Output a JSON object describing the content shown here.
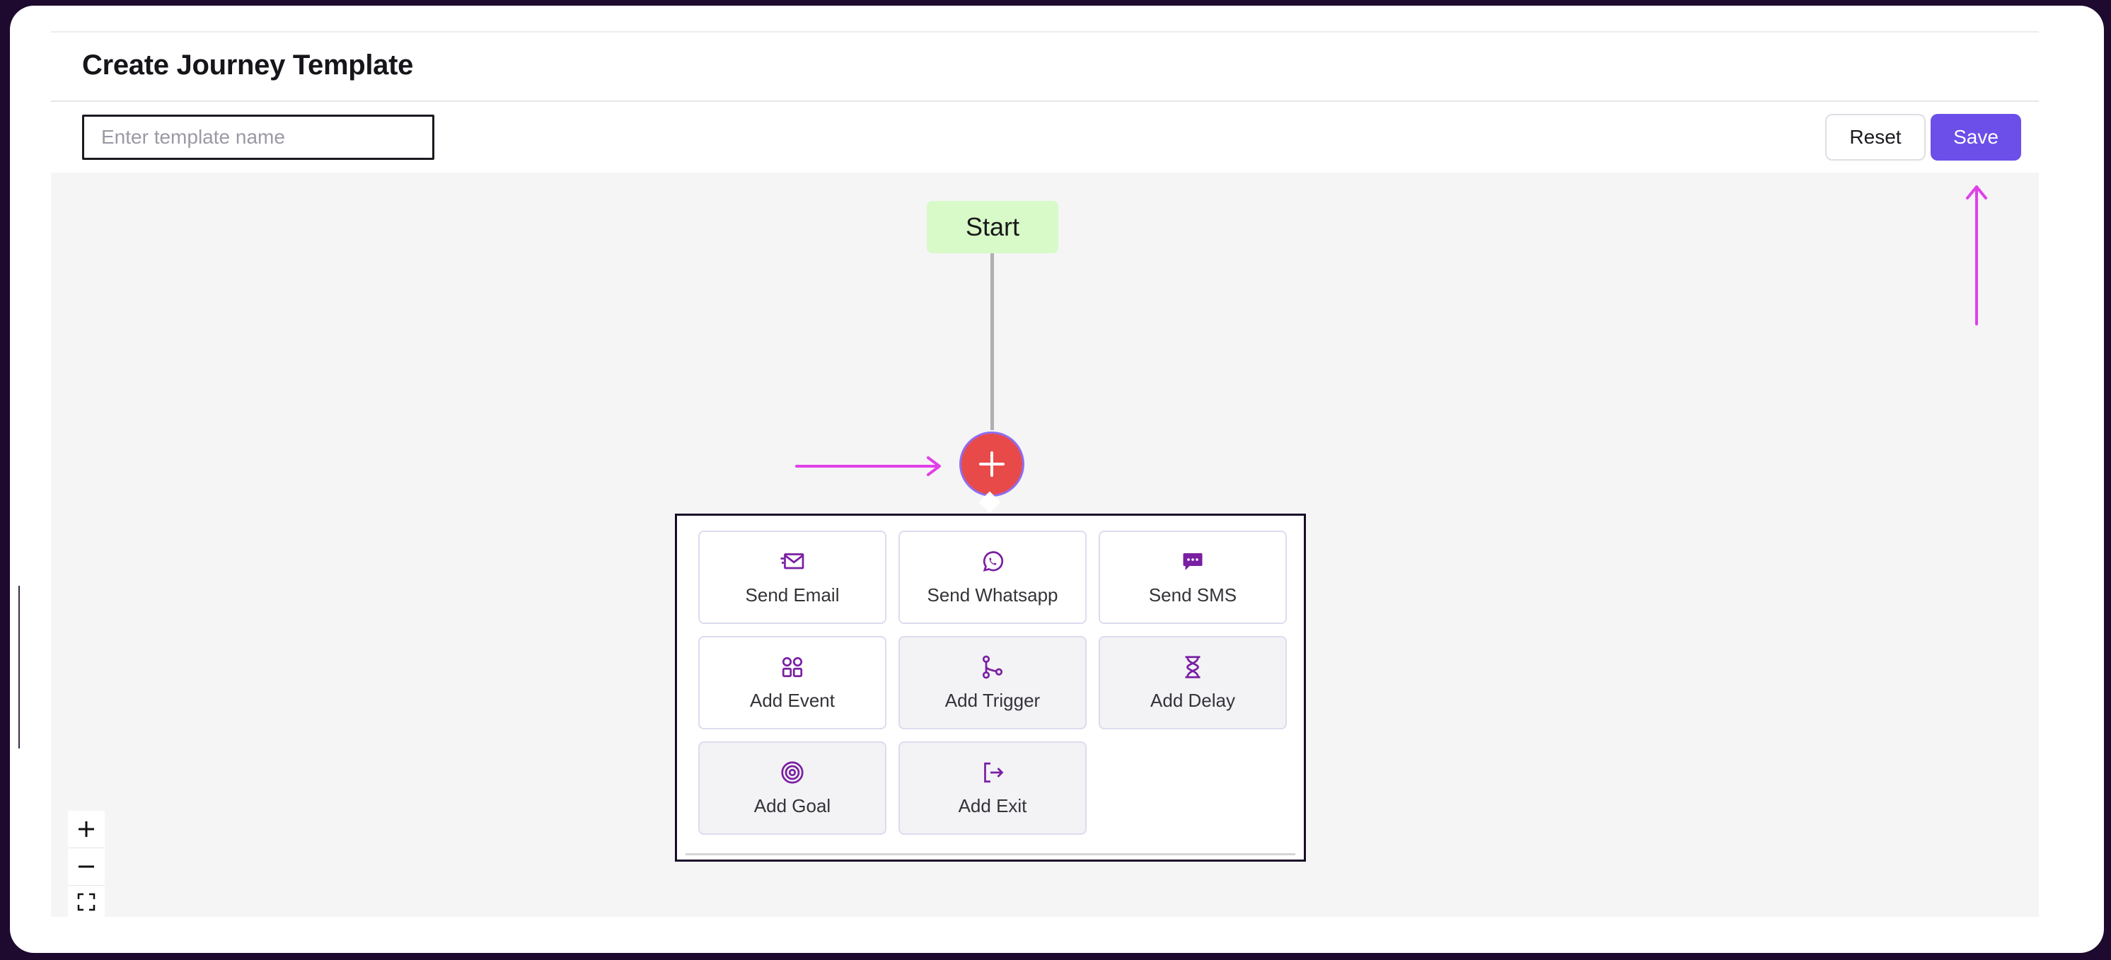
{
  "header": {
    "title": "Create Journey Template"
  },
  "template_name": {
    "placeholder": "Enter template name",
    "value": ""
  },
  "toolbar": {
    "reset_label": "Reset",
    "save_label": "Save"
  },
  "canvas": {
    "start_node": {
      "label": "Start"
    },
    "add_node": {
      "icon": "plus-icon"
    }
  },
  "action_menu": {
    "items": [
      {
        "label": "Send Email",
        "icon": "email-icon"
      },
      {
        "label": "Send Whatsapp",
        "icon": "whatsapp-icon"
      },
      {
        "label": "Send SMS",
        "icon": "sms-icon"
      },
      {
        "label": "Add Event",
        "icon": "event-icon"
      },
      {
        "label": "Add Trigger",
        "icon": "trigger-icon"
      },
      {
        "label": "Add Delay",
        "icon": "hourglass-icon"
      },
      {
        "label": "Add Goal",
        "icon": "target-icon"
      },
      {
        "label": "Add Exit",
        "icon": "exit-icon"
      }
    ]
  },
  "zoom_controls": {
    "icons": [
      "zoom-in-icon",
      "zoom-out-icon",
      "fit-view-icon"
    ]
  },
  "colors": {
    "accent": "#6b4fe8",
    "add_node": "#e84a4a",
    "start_node": "#d8f9c8",
    "icon": "#7a1fa2",
    "annotation": "#e040e8",
    "frame": "#1e0a2e"
  }
}
